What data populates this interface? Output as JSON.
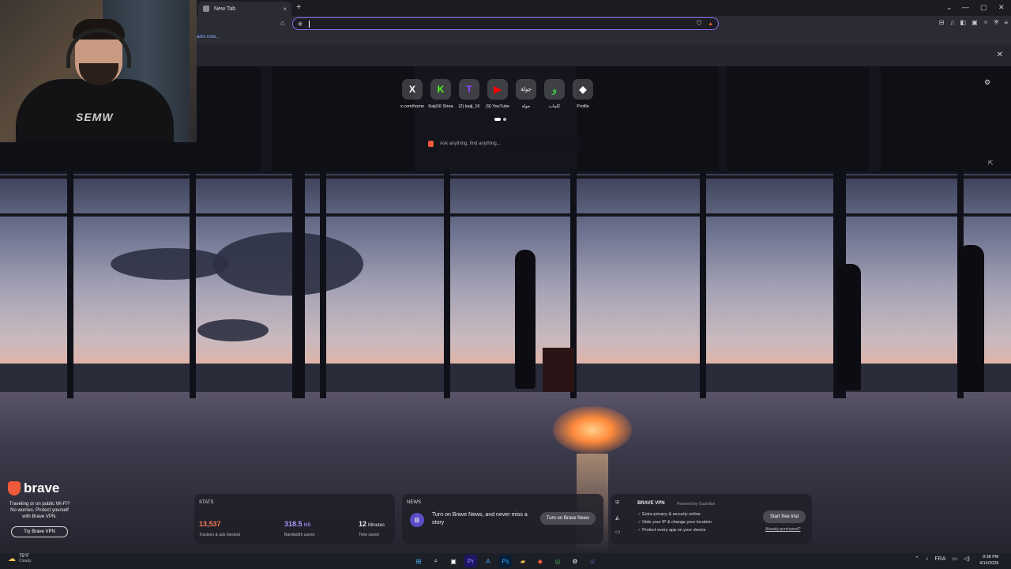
{
  "browser": {
    "tab_title": "New Tab",
    "new_tab_symbol": "+",
    "tab_close_symbol": "×",
    "bookmark_bar_link": "arks now...",
    "window_controls": [
      "⌄",
      "—",
      "▢",
      "✕"
    ]
  },
  "shortcuts": [
    {
      "label": "x.com/home",
      "glyph": "X",
      "color": "#ffffff"
    },
    {
      "label": "Kaiji16 Strea",
      "glyph": "K",
      "color": "#53fc18"
    },
    {
      "label": "(2) kaiji_16",
      "glyph": "T",
      "color": "#9146ff"
    },
    {
      "label": "(9) YouTube",
      "glyph": "▶",
      "color": "#ff0000"
    },
    {
      "label": "جولة",
      "glyph": "جولة",
      "color": "#c9c9c9"
    },
    {
      "label": "كلمات",
      "glyph": "و",
      "color": "#3fbf4a"
    },
    {
      "label": "Profile",
      "glyph": "◆",
      "color": "#ffffff"
    }
  ],
  "search": {
    "placeholder": "Ask anything, find anything..."
  },
  "promo": {
    "brand": "brave",
    "text": "Traveling or on public Wi-Fi? No worries. Protect yourself with Brave VPN.",
    "button": "Try Brave VPN"
  },
  "stats": {
    "title": "STATS",
    "trackers_value": "13,537",
    "trackers_label": "Trackers & ads blocked",
    "bandwidth_value": "318.5",
    "bandwidth_unit": "MB",
    "bandwidth_label": "Bandwidth saved",
    "time_value": "12",
    "time_unit": "Minutes",
    "time_label": "Time saved",
    "colors": {
      "trackers": "#ff7a52",
      "bandwidth": "#a99cff",
      "time": "#ffffff"
    }
  },
  "news": {
    "title": "NEWS",
    "text": "Turn on Brave News, and never miss a story",
    "button": "Turn on Brave News"
  },
  "vpn": {
    "title": "BRAVE VPN",
    "powered": "Powered by Guardian",
    "features": [
      "Extra privacy & security online",
      "Hide your IP & change your location",
      "Protect every app on your device"
    ],
    "button": "Start free trial",
    "link": "Already purchased?"
  },
  "taskbar": {
    "temperature": "75°F",
    "condition": "Cloudy",
    "language": "FRA",
    "time": "9:38 PM",
    "date": "4/14/2026"
  },
  "webcam": {
    "shirt_text": "SEMW"
  }
}
